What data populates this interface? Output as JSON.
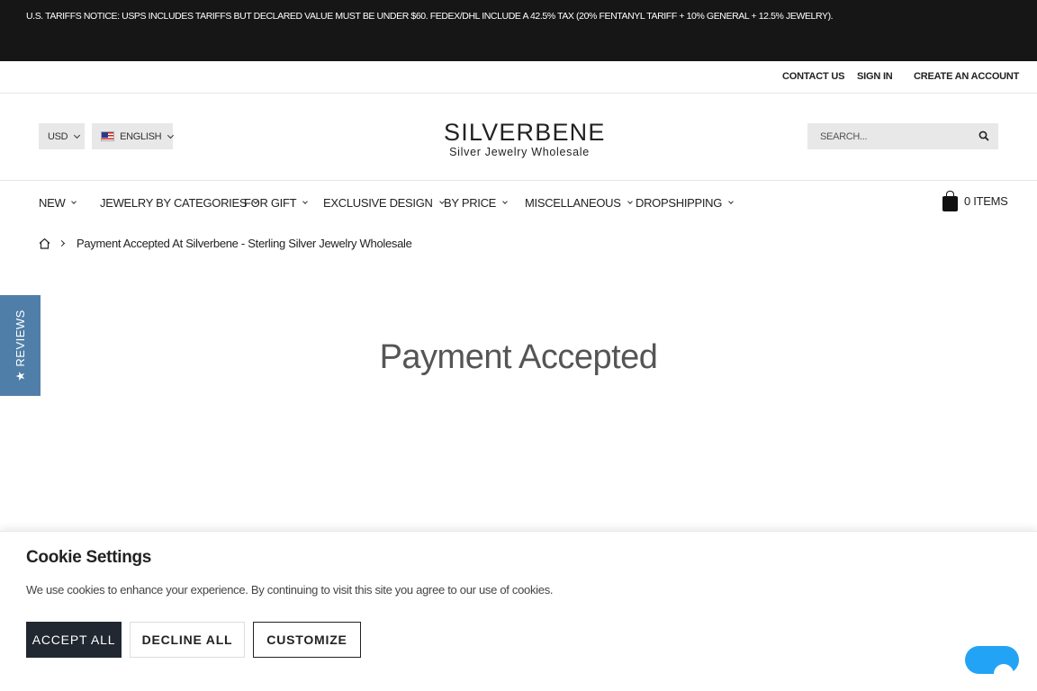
{
  "notice": {
    "text": "U.S. TARIFFS NOTICE: USPS INCLUDES TARIFFS BUT DECLARED VALUE MUST BE UNDER $60. FEDEX/DHL INCLUDE A 42.5% TAX (20% FENTANYL TARIFF + 10% GENERAL + 12.5% JEWELRY)."
  },
  "account_bar": {
    "contact": "CONTACT US",
    "sign_in": "SIGN IN",
    "create": "CREATE AN ACCOUNT"
  },
  "header": {
    "currency": "USD",
    "language": "ENGLISH",
    "logo_main": "SILVERBENE",
    "logo_sub": "Silver Jewelry Wholesale",
    "search_placeholder": "SEARCH..."
  },
  "nav": {
    "items": [
      "NEW",
      "JEWELRY BY CATEGORIES",
      "FOR GIFT",
      "EXCLUSIVE DESIGN",
      "BY PRICE",
      "MISCELLANEOUS",
      "DROPSHIPPING"
    ],
    "cart_label": "0 ITEMS"
  },
  "breadcrumb": {
    "current": "Payment Accepted At Silverbene - Sterling Silver Jewelry Wholesale"
  },
  "reviews_tab": "★ REVIEWS",
  "page_title": "Payment Accepted",
  "cookie": {
    "title": "Cookie Settings",
    "text": "We use cookies to enhance your experience. By continuing to visit this site you agree to our use of cookies.",
    "accept": "ACCEPT ALL",
    "decline": "DECLINE ALL",
    "customize": "CUSTOMIZE"
  },
  "colors": {
    "notice_bg": "#161616",
    "reviews_bg": "#4f7fa9",
    "accept_bg": "#222831",
    "chat_bg": "#23a3f5"
  }
}
